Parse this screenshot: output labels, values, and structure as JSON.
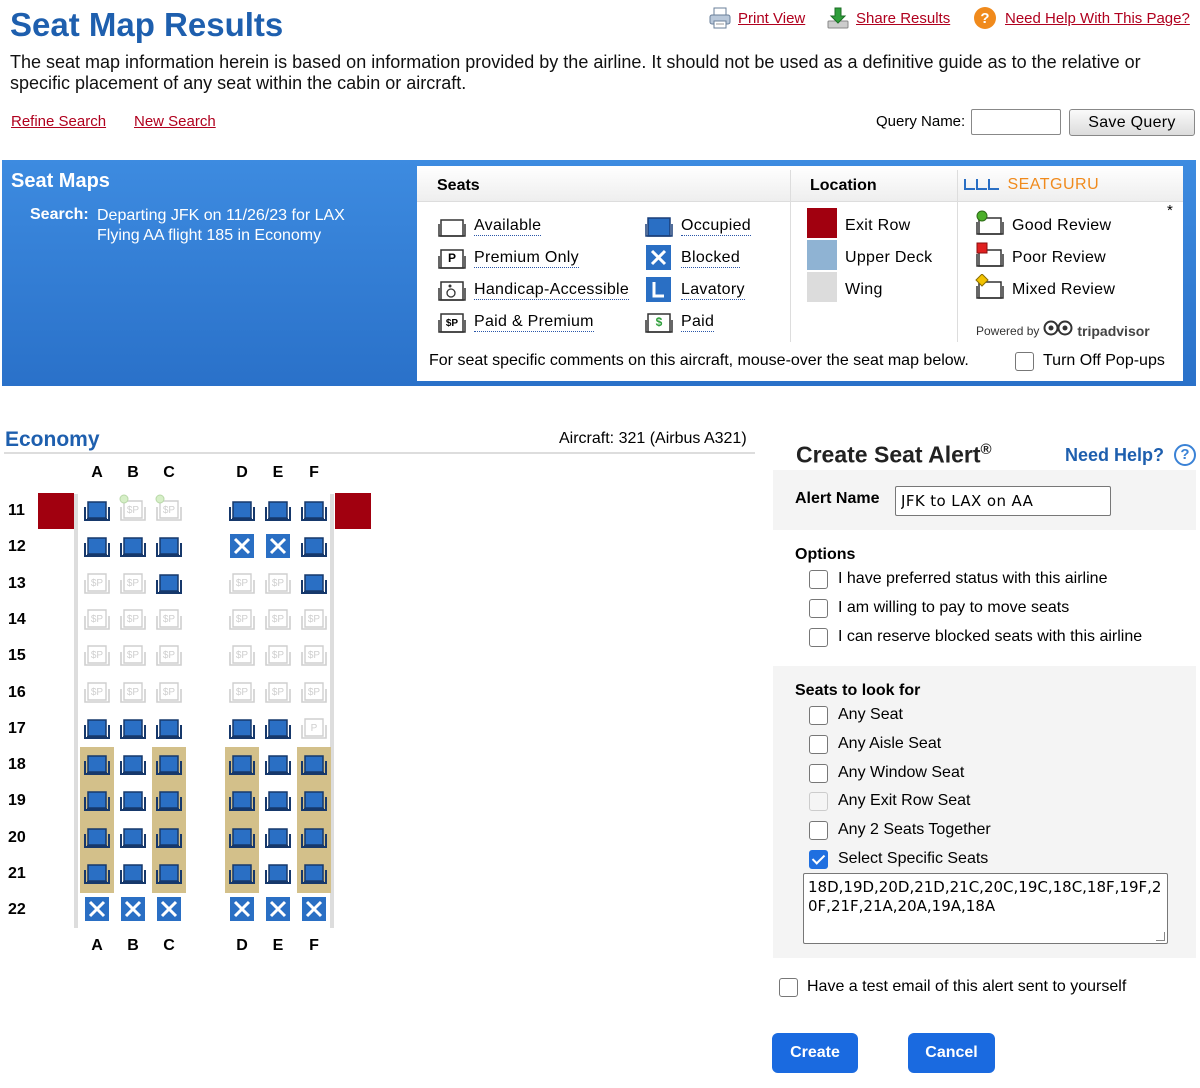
{
  "header": {
    "title": "Seat Map Results",
    "disclaimer": "The seat map information herein is based on information provided by the airline. It should not be used as a definitive guide as to the relative or specific placement of any seat within the cabin or aircraft.",
    "print_view": "Print View",
    "share_results": "Share Results",
    "need_help_page": "Need Help With This Page?",
    "refine_search": "Refine Search",
    "new_search": "New Search",
    "query_name_label": "Query Name:",
    "query_name_value": "",
    "save_query": "Save Query"
  },
  "seat_maps": {
    "title": "Seat Maps",
    "search_label": "Search:",
    "search_line1": "Departing JFK on 11/26/23 for LAX",
    "search_line2": "Flying AA flight 185 in Economy"
  },
  "legend": {
    "seats_header": "Seats",
    "location_header": "Location",
    "seatguru_brand": "SEATGURU",
    "available": "Available",
    "premium_only": "Premium Only",
    "handicap": "Handicap-Accessible",
    "paid_premium": "Paid & Premium",
    "occupied": "Occupied",
    "blocked": "Blocked",
    "lavatory": "Lavatory",
    "paid": "Paid",
    "exit_row": "Exit Row",
    "upper_deck": "Upper Deck",
    "wing": "Wing",
    "good_review": "Good Review",
    "poor_review": "Poor Review",
    "mixed_review": "Mixed Review",
    "asterisk": "*",
    "powered_by": "Powered by",
    "tripadvisor": "tripadvisor",
    "footer": "For seat specific comments on this aircraft, mouse-over the seat map below.",
    "popups_label": "Turn Off Pop-ups",
    "popups_off": false,
    "colors": {
      "exit_row": "#a1000f",
      "upper_deck": "#8fb3d3",
      "wing": "#dcdcdc",
      "seat_blue": "#2a6fc4"
    }
  },
  "seatmap": {
    "cabin": "Economy",
    "aircraft": "Aircraft: 321 (Airbus A321)",
    "columns": [
      "A",
      "B",
      "C",
      "D",
      "E",
      "F"
    ],
    "exit_rows": [
      "11"
    ],
    "rows": [
      {
        "num": "11",
        "seats": [
          "occ",
          "psp",
          "psp",
          "occ",
          "occ",
          "occ"
        ],
        "reviews": [
          null,
          "good",
          "good",
          null,
          null,
          null
        ]
      },
      {
        "num": "12",
        "seats": [
          "occ",
          "occ",
          "occ",
          "blk",
          "blk",
          "occ"
        ]
      },
      {
        "num": "13",
        "seats": [
          "psp",
          "psp",
          "occ",
          "psp",
          "psp",
          "occ"
        ]
      },
      {
        "num": "14",
        "seats": [
          "psp",
          "psp",
          "psp",
          "psp",
          "psp",
          "psp"
        ]
      },
      {
        "num": "15",
        "seats": [
          "psp",
          "psp",
          "psp",
          "psp",
          "psp",
          "psp"
        ]
      },
      {
        "num": "16",
        "seats": [
          "psp",
          "psp",
          "psp",
          "psp",
          "psp",
          "psp"
        ]
      },
      {
        "num": "17",
        "seats": [
          "occ",
          "occ",
          "occ",
          "occ",
          "occ",
          "prem"
        ]
      },
      {
        "num": "18",
        "seats": [
          "occ",
          "occ",
          "occ",
          "occ",
          "occ",
          "occ"
        ],
        "highlight": [
          true,
          false,
          true,
          true,
          false,
          true
        ]
      },
      {
        "num": "19",
        "seats": [
          "occ",
          "occ",
          "occ",
          "occ",
          "occ",
          "occ"
        ],
        "highlight": [
          true,
          false,
          true,
          true,
          false,
          true
        ]
      },
      {
        "num": "20",
        "seats": [
          "occ",
          "occ",
          "occ",
          "occ",
          "occ",
          "occ"
        ],
        "highlight": [
          true,
          false,
          true,
          true,
          false,
          true
        ]
      },
      {
        "num": "21",
        "seats": [
          "occ",
          "occ",
          "occ",
          "occ",
          "occ",
          "occ"
        ],
        "highlight": [
          true,
          false,
          true,
          true,
          false,
          true
        ]
      },
      {
        "num": "22",
        "seats": [
          "blk",
          "blk",
          "blk",
          "blk",
          "blk",
          "blk"
        ]
      }
    ]
  },
  "alert": {
    "title": "Create Seat Alert",
    "reg": "®",
    "need_help": "Need Help?",
    "help_glyph": "?",
    "name_label": "Alert Name",
    "name_value": "JFK to LAX on AA",
    "options_label": "Options",
    "options": [
      {
        "label": "I have preferred status with this airline",
        "checked": false
      },
      {
        "label": "I am willing to pay to move seats",
        "checked": false
      },
      {
        "label": "I can reserve blocked seats with this airline",
        "checked": false
      }
    ],
    "seats_label": "Seats to look for",
    "seat_options": [
      {
        "label": "Any Seat",
        "checked": false,
        "disabled": false
      },
      {
        "label": "Any Aisle Seat",
        "checked": false,
        "disabled": false
      },
      {
        "label": "Any Window Seat",
        "checked": false,
        "disabled": false
      },
      {
        "label": "Any Exit Row Seat",
        "checked": false,
        "disabled": true
      },
      {
        "label": "Any 2 Seats Together",
        "checked": false,
        "disabled": false
      },
      {
        "label": "Select Specific Seats",
        "checked": true,
        "disabled": false
      }
    ],
    "specific_seats": "18D,19D,20D,21D,21C,20C,19C,18C,18F,19F,20F,21F,21A,20A,19A,18A",
    "test_email_label": "Have a test email of this alert sent to yourself",
    "test_email": false,
    "create": "Create",
    "cancel": "Cancel"
  }
}
